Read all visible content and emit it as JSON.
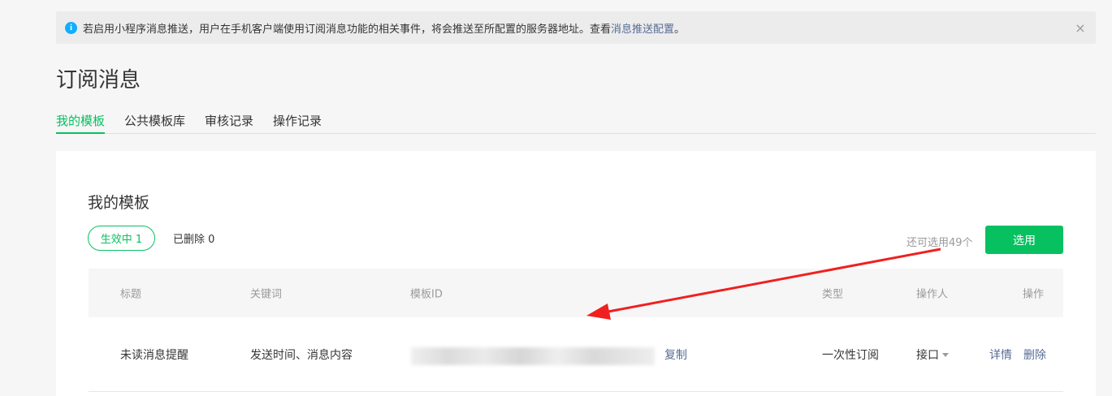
{
  "notice": {
    "text": "若启用小程序消息推送，用户在手机客户端使用订阅消息功能的相关事件，将会推送至所配置的服务器地址。查看 ",
    "link": "消息推送配置",
    "suffix": "。",
    "info_glyph": "i",
    "close_glyph": "×"
  },
  "page_title": "订阅消息",
  "tabs": [
    {
      "label": "我的模板",
      "active": true
    },
    {
      "label": "公共模板库",
      "active": false
    },
    {
      "label": "审核记录",
      "active": false
    },
    {
      "label": "操作记录",
      "active": false
    }
  ],
  "card": {
    "title": "我的模板",
    "filter_active": "生效中  1",
    "filter_deleted": "已删除  0",
    "remaining": "还可选用49个",
    "select_button": "选用"
  },
  "table": {
    "headers": [
      "标题",
      "关键词",
      "模板ID",
      "类型",
      "操作人",
      "操作"
    ],
    "rows": [
      {
        "title": "未读消息提醒",
        "keywords": "发送时间、消息内容",
        "template_id": "",
        "copy": "复制",
        "type": "一次性订阅",
        "operator": "接口",
        "detail": "详情",
        "delete": "删除"
      }
    ]
  },
  "colors": {
    "accent": "#07c160",
    "link": "#576b95",
    "annotation_arrow": "#f02020"
  }
}
